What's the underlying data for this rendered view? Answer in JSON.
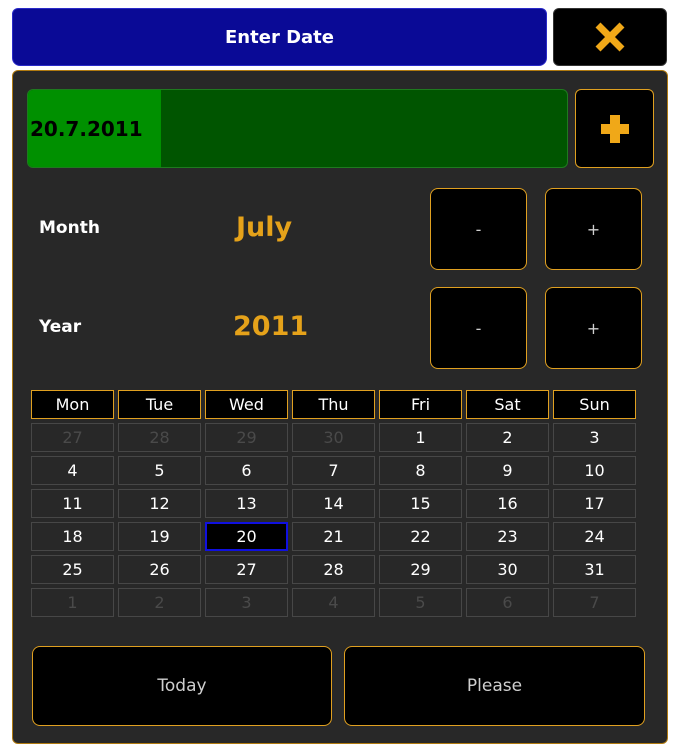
{
  "title": "Enter Date",
  "icons": {
    "close": "close-icon",
    "add": "plus-icon"
  },
  "colors": {
    "title_bar": "#0a0a96",
    "accent": "#e5a21a",
    "date_field": "#005500",
    "date_selection": "#009000",
    "selected_day_border": "#1010e0"
  },
  "date_input": {
    "value": "20.7.2011"
  },
  "month": {
    "label": "Month",
    "value": "July",
    "minus": "-",
    "plus": "+"
  },
  "year": {
    "label": "Year",
    "value": "2011",
    "minus": "-",
    "plus": "+"
  },
  "calendar": {
    "weekdays": [
      "Mon",
      "Tue",
      "Wed",
      "Thu",
      "Fri",
      "Sat",
      "Sun"
    ],
    "selected_day": "20",
    "weeks": [
      [
        {
          "d": "27",
          "cur": false
        },
        {
          "d": "28",
          "cur": false
        },
        {
          "d": "29",
          "cur": false
        },
        {
          "d": "30",
          "cur": false
        },
        {
          "d": "1",
          "cur": true
        },
        {
          "d": "2",
          "cur": true
        },
        {
          "d": "3",
          "cur": true
        }
      ],
      [
        {
          "d": "4",
          "cur": true
        },
        {
          "d": "5",
          "cur": true
        },
        {
          "d": "6",
          "cur": true
        },
        {
          "d": "7",
          "cur": true
        },
        {
          "d": "8",
          "cur": true
        },
        {
          "d": "9",
          "cur": true
        },
        {
          "d": "10",
          "cur": true
        }
      ],
      [
        {
          "d": "11",
          "cur": true
        },
        {
          "d": "12",
          "cur": true
        },
        {
          "d": "13",
          "cur": true
        },
        {
          "d": "14",
          "cur": true
        },
        {
          "d": "15",
          "cur": true
        },
        {
          "d": "16",
          "cur": true
        },
        {
          "d": "17",
          "cur": true
        }
      ],
      [
        {
          "d": "18",
          "cur": true
        },
        {
          "d": "19",
          "cur": true
        },
        {
          "d": "20",
          "cur": true
        },
        {
          "d": "21",
          "cur": true
        },
        {
          "d": "22",
          "cur": true
        },
        {
          "d": "23",
          "cur": true
        },
        {
          "d": "24",
          "cur": true
        }
      ],
      [
        {
          "d": "25",
          "cur": true
        },
        {
          "d": "26",
          "cur": true
        },
        {
          "d": "27",
          "cur": true
        },
        {
          "d": "28",
          "cur": true
        },
        {
          "d": "29",
          "cur": true
        },
        {
          "d": "30",
          "cur": true
        },
        {
          "d": "31",
          "cur": true
        }
      ],
      [
        {
          "d": "1",
          "cur": false
        },
        {
          "d": "2",
          "cur": false
        },
        {
          "d": "3",
          "cur": false
        },
        {
          "d": "4",
          "cur": false
        },
        {
          "d": "5",
          "cur": false
        },
        {
          "d": "6",
          "cur": false
        },
        {
          "d": "7",
          "cur": false
        }
      ]
    ]
  },
  "buttons": {
    "today": "Today",
    "please": "Please"
  }
}
